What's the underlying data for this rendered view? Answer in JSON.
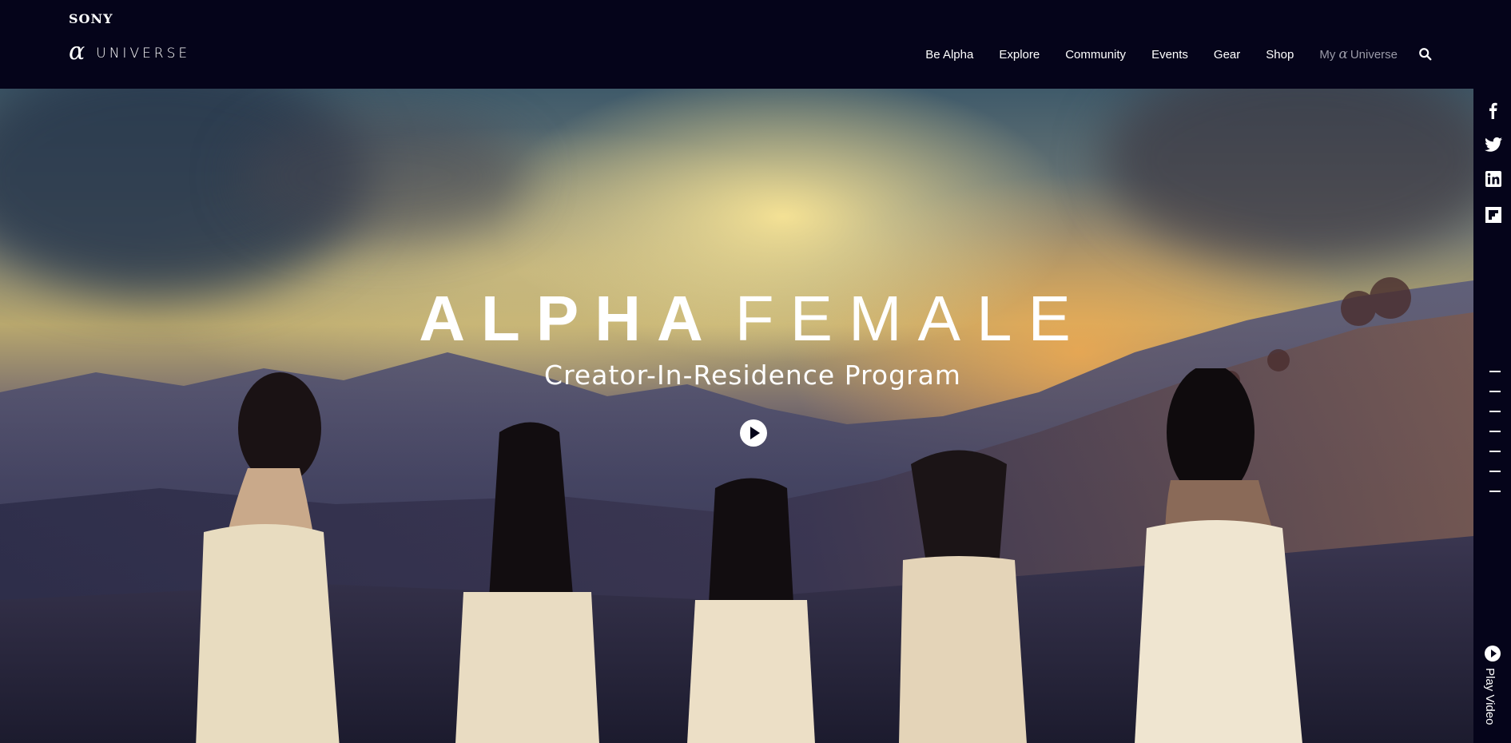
{
  "header": {
    "brand_company": "SONY",
    "brand_glyph": "α",
    "brand_name": "UNIVERSE",
    "nav": [
      {
        "label": "Be Alpha"
      },
      {
        "label": "Explore"
      },
      {
        "label": "Community"
      },
      {
        "label": "Events"
      },
      {
        "label": "Gear"
      },
      {
        "label": "Shop"
      }
    ],
    "my_universe": {
      "prefix": "My",
      "glyph": "α",
      "suffix": "Universe"
    },
    "search_icon": "search-icon"
  },
  "hero": {
    "title_bold": "ALPHA",
    "title_light": "FEMALE",
    "subtitle": "Creator-In-Residence Program",
    "play_icon": "play-icon"
  },
  "rail": {
    "social": [
      "facebook-icon",
      "twitter-icon",
      "linkedin-icon",
      "flipboard-icon"
    ],
    "section_markers": 7,
    "play_label": "Play Video"
  },
  "colors": {
    "header_bg": "#05041a",
    "text": "#ffffff",
    "muted_nav": "#9a9aa8"
  }
}
